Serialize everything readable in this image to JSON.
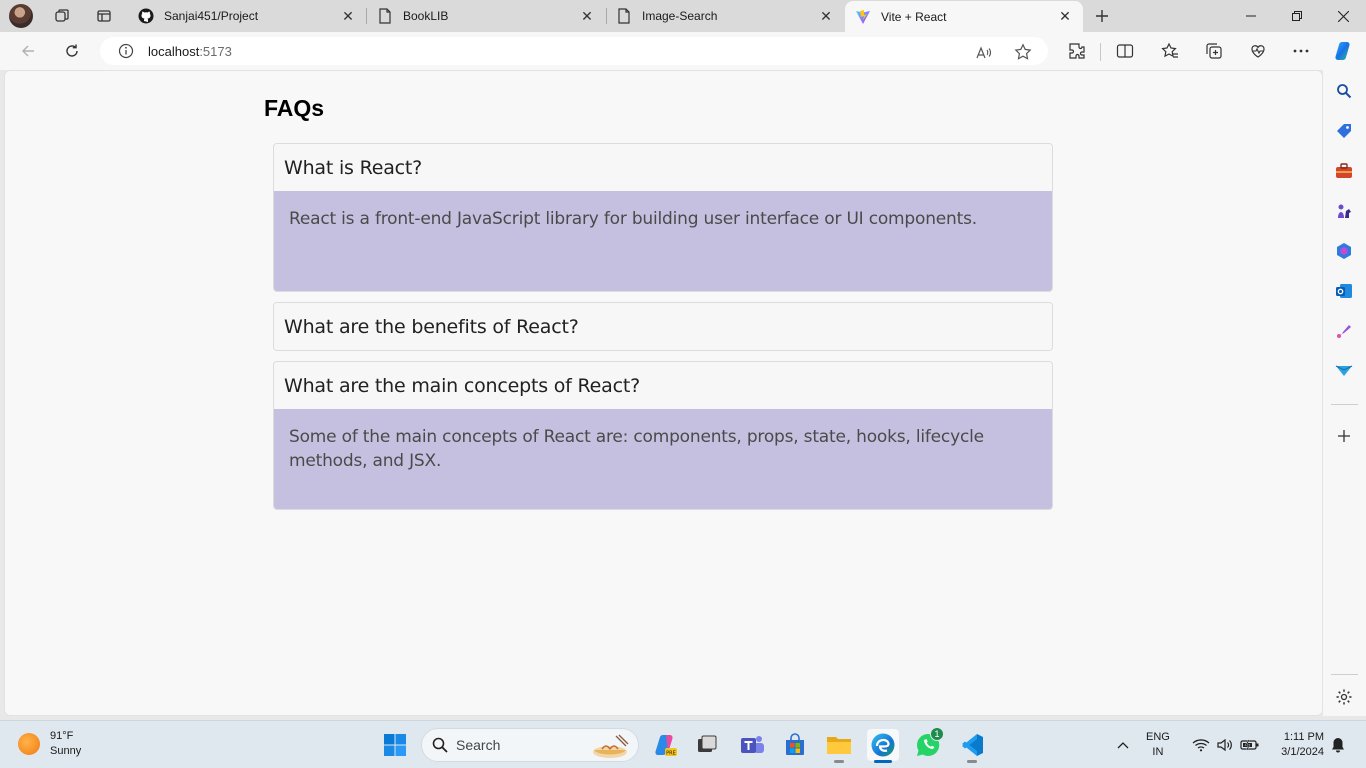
{
  "browser": {
    "tabs": [
      {
        "title": "Sanjai451/Project",
        "icon": "github-icon"
      },
      {
        "title": "BookLIB",
        "icon": "page-icon"
      },
      {
        "title": "Image-Search",
        "icon": "page-icon"
      },
      {
        "title": "Vite + React",
        "icon": "vite-icon",
        "active": true
      }
    ],
    "address": {
      "host": "localhost",
      "port": ":5173"
    }
  },
  "page": {
    "heading": "FAQs",
    "faqs": [
      {
        "question": "What is React?",
        "answer": "React is a front-end JavaScript library for building user interface or UI components.",
        "expanded": true
      },
      {
        "question": "What are the benefits of React?",
        "answer": "",
        "expanded": false
      },
      {
        "question": "What are the main concepts of React?",
        "answer": "Some of the main concepts of React are: components, props, state, hooks, lifecycle methods, and JSX.",
        "expanded": true
      }
    ]
  },
  "taskbar": {
    "weather": {
      "temp": "91°F",
      "condition": "Sunny"
    },
    "search_label": "Search",
    "whatsapp_badge": "1",
    "language": {
      "lang": "ENG",
      "region": "IN"
    },
    "clock": {
      "time": "1:11 PM",
      "date": "3/1/2024"
    }
  },
  "colors": {
    "answer_bg": "#c5c0e0",
    "page_bg": "#f8f8f8",
    "edge_blue": "#0067c0"
  }
}
